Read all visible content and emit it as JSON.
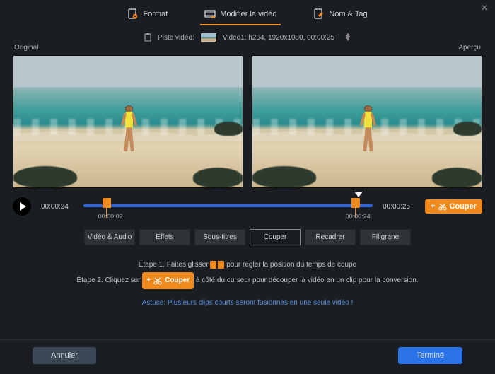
{
  "top_tabs": {
    "format": "Format",
    "modify": "Modifier la vidéo",
    "name_tag": "Nom & Tag"
  },
  "track": {
    "label": "Piste vidéo:",
    "value": "Video1: h264, 1920x1080, 00:00:25"
  },
  "preview": {
    "original_label": "Original",
    "preview_label": "Aperçu"
  },
  "timeline": {
    "current": "00:00:24",
    "total": "00:00:25",
    "left_handle": "00:00:02",
    "right_handle": "00:00:24",
    "cut_button": "Couper"
  },
  "sub_tabs": {
    "video_audio": "Vidéo  & Audio",
    "effects": "Effets",
    "subtitles": "Sous-titres",
    "cut": "Couper",
    "crop": "Recadrer",
    "watermark": "Filigrane"
  },
  "help": {
    "step1_a": "Étape 1. Faites glisser",
    "step1_b": "pour régler la position du temps de coupe",
    "step2_a": "Étape 2. Cliquez sur",
    "step2_btn": "Couper",
    "step2_b": "à côté du curseur pour découper la vidéo en un clip pour la conversion.",
    "tip": "Astuce: Plusieurs clips courts seront fusionnés en une seule vidéo !"
  },
  "footer": {
    "cancel": "Annuler",
    "done": "Terminé"
  }
}
